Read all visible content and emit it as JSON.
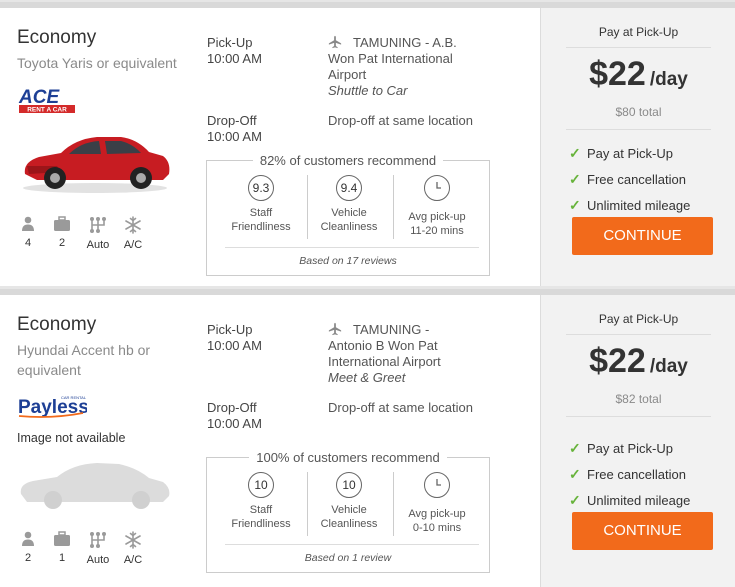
{
  "colors": {
    "accent": "#f26a1b",
    "check": "#67b33b",
    "card_divider": "#d9d9d9",
    "price_panel": "#f2f2f2"
  },
  "cards": [
    {
      "category": "Economy",
      "model": "Toyota Yaris or equivalent",
      "logo_text": "ACE",
      "logo_sub": "RENT A CAR",
      "image_note": "",
      "features": [
        {
          "icon": "person-icon",
          "value": "4"
        },
        {
          "icon": "suitcase-icon",
          "value": "2"
        },
        {
          "icon": "gearshift-icon",
          "value": "Auto"
        },
        {
          "icon": "snowflake-icon",
          "value": "A/C"
        }
      ],
      "pickup": {
        "label": "Pick-Up",
        "time": "10:00 AM",
        "location_lines": [
          "TAMUNING - A.B.",
          "Won Pat International",
          "Airport"
        ],
        "service": "Shuttle to Car"
      },
      "dropoff": {
        "label": "Drop-Off",
        "time": "10:00 AM",
        "location": "Drop-off at same location"
      },
      "recommend": {
        "title": "82% of customers recommend",
        "metrics": [
          {
            "value": "9.3",
            "label_lines": [
              "Staff",
              "Friendliness"
            ]
          },
          {
            "value": "9.4",
            "label_lines": [
              "Vehicle",
              "Cleanliness"
            ]
          },
          {
            "value": "",
            "icon": "clock-icon",
            "label_lines": [
              "Avg pick-up",
              "11-20 mins"
            ]
          }
        ],
        "based_on": "Based on 17 reviews"
      },
      "pricing": {
        "pay_label": "Pay at Pick-Up",
        "amount": "$22",
        "per": "/day",
        "total": "$80 total",
        "benefits": [
          "Pay at Pick-Up",
          "Free cancellation",
          "Unlimited mileage"
        ],
        "button": "CONTINUE"
      }
    },
    {
      "category": "Economy",
      "model": "Hyundai Accent hb or equivalent",
      "logo_text": "Payless",
      "logo_sub": "CAR RENTAL",
      "image_note": "Image not available",
      "features": [
        {
          "icon": "person-icon",
          "value": "2"
        },
        {
          "icon": "suitcase-icon",
          "value": "1"
        },
        {
          "icon": "gearshift-icon",
          "value": "Auto"
        },
        {
          "icon": "snowflake-icon",
          "value": "A/C"
        }
      ],
      "pickup": {
        "label": "Pick-Up",
        "time": "10:00 AM",
        "location_lines": [
          "TAMUNING -",
          "Antonio B Won Pat",
          "International Airport"
        ],
        "service": "Meet & Greet"
      },
      "dropoff": {
        "label": "Drop-Off",
        "time": "10:00 AM",
        "location": "Drop-off at same location"
      },
      "recommend": {
        "title": "100% of customers recommend",
        "metrics": [
          {
            "value": "10",
            "label_lines": [
              "Staff",
              "Friendliness"
            ]
          },
          {
            "value": "10",
            "label_lines": [
              "Vehicle",
              "Cleanliness"
            ]
          },
          {
            "value": "",
            "icon": "clock-icon",
            "label_lines": [
              "Avg pick-up",
              "0-10 mins"
            ]
          }
        ],
        "based_on": "Based on 1 review"
      },
      "pricing": {
        "pay_label": "Pay at Pick-Up",
        "amount": "$22",
        "per": "/day",
        "total": "$82 total",
        "benefits": [
          "Pay at Pick-Up",
          "Free cancellation",
          "Unlimited mileage"
        ],
        "button": "CONTINUE"
      }
    }
  ]
}
